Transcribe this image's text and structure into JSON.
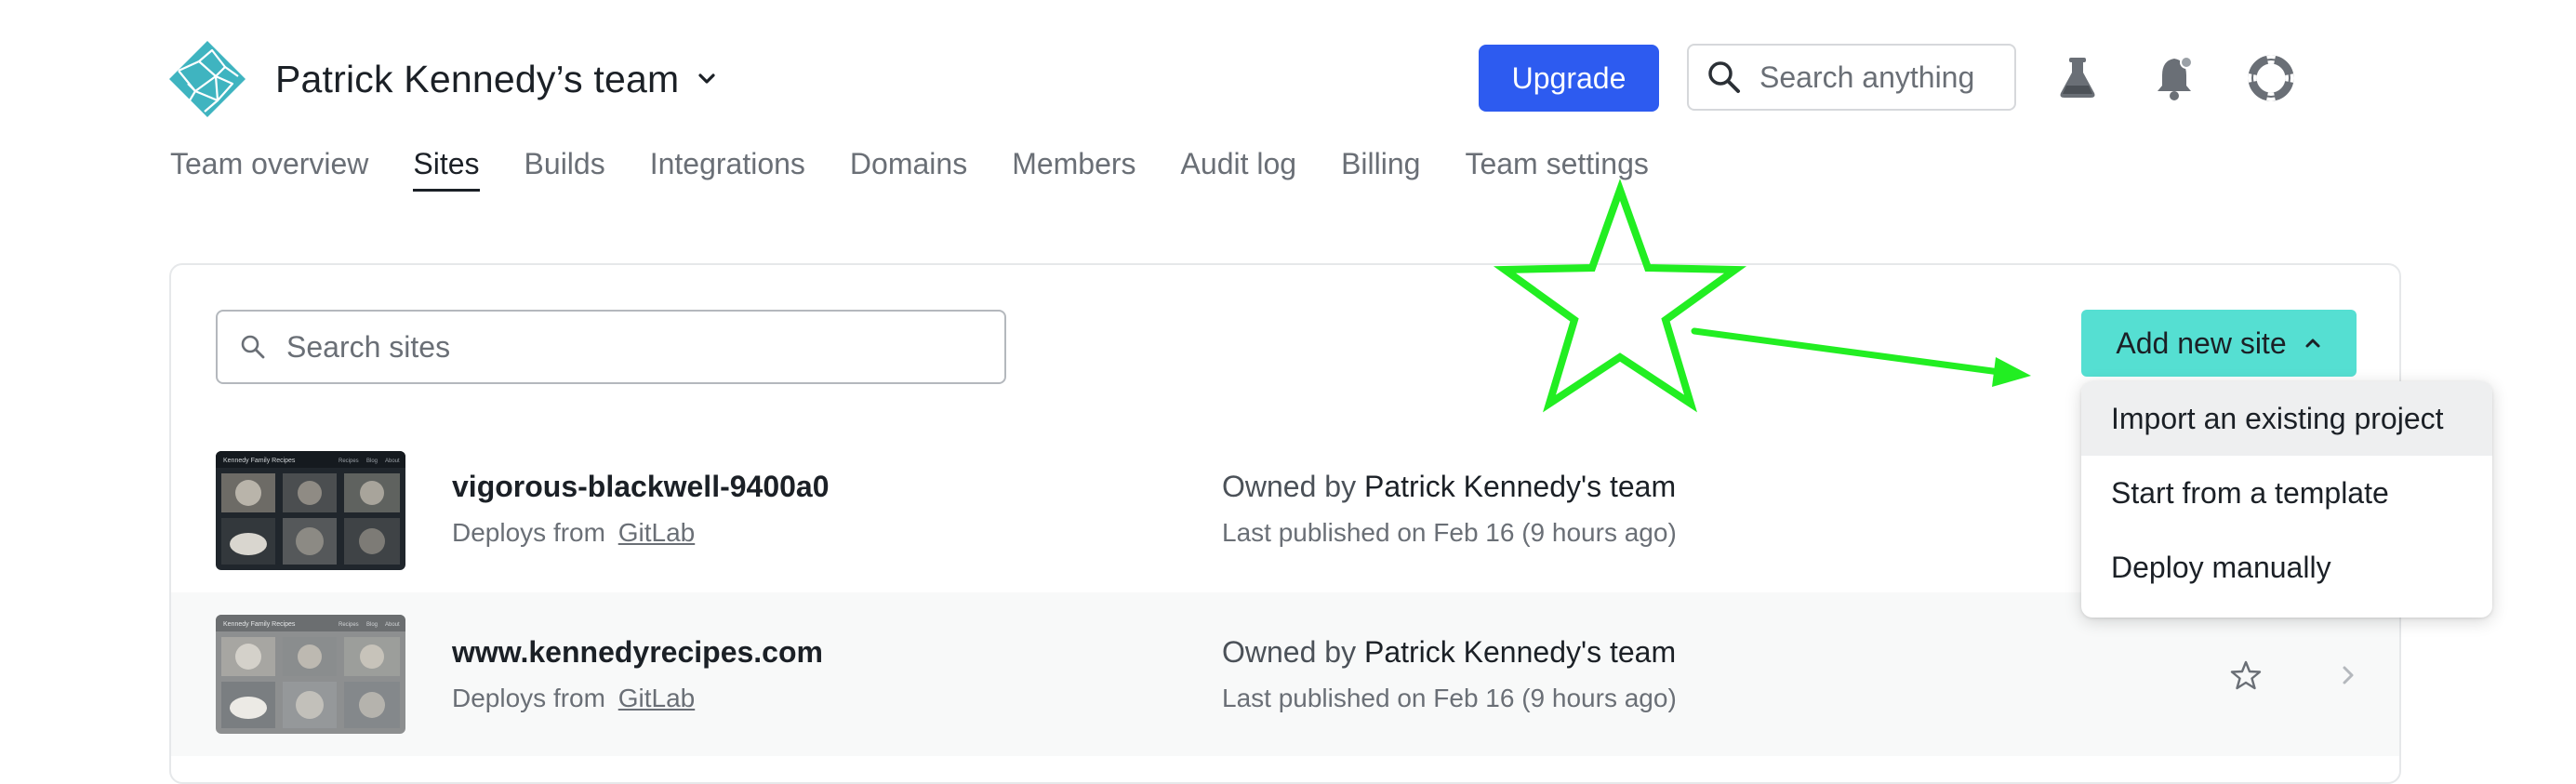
{
  "header": {
    "team_name": "Patrick Kennedy’s team",
    "upgrade_label": "Upgrade",
    "search_placeholder": "Search anything",
    "icons": [
      "flask-icon",
      "bell-icon",
      "lifebuoy-icon"
    ],
    "colors": {
      "upgrade": "#2d5bf0",
      "logo": "#3fb4c0"
    }
  },
  "nav": {
    "items": [
      {
        "label": "Team overview"
      },
      {
        "label": "Sites",
        "active": true
      },
      {
        "label": "Builds"
      },
      {
        "label": "Integrations"
      },
      {
        "label": "Domains"
      },
      {
        "label": "Members"
      },
      {
        "label": "Audit log"
      },
      {
        "label": "Billing"
      },
      {
        "label": "Team settings"
      }
    ]
  },
  "sites": {
    "search_placeholder": "Search sites",
    "add_button_label": "Add new site",
    "add_button_color": "#55dfd2",
    "dropdown": {
      "items": [
        {
          "label": "Import an existing project",
          "highlighted": true
        },
        {
          "label": "Start from a template"
        },
        {
          "label": "Deploy manually"
        }
      ]
    },
    "rows": [
      {
        "name": "vigorous-blackwell-9400a0",
        "deploys_prefix": "Deploys from",
        "deploys_source": "GitLab",
        "owned_prefix": "Owned by",
        "owner": "Patrick Kennedy's team",
        "published": "Last published on Feb 16 (9 hours ago)",
        "thumbnail_title": "Kennedy Family Recipes",
        "thumbnail_nav": [
          "Recipes",
          "Blog",
          "About"
        ]
      },
      {
        "name": "www.kennedyrecipes.com",
        "deploys_prefix": "Deploys from",
        "deploys_source": "GitLab",
        "owned_prefix": "Owned by",
        "owner": "Patrick Kennedy's team",
        "published": "Last published on Feb 16 (9 hours ago)",
        "thumbnail_title": "Kennedy Family Recipes",
        "thumbnail_nav": [
          "Recipes",
          "Blog",
          "About"
        ]
      }
    ]
  },
  "annotation": {
    "color": "#22ee22",
    "shapes": [
      "star",
      "arrow"
    ]
  }
}
